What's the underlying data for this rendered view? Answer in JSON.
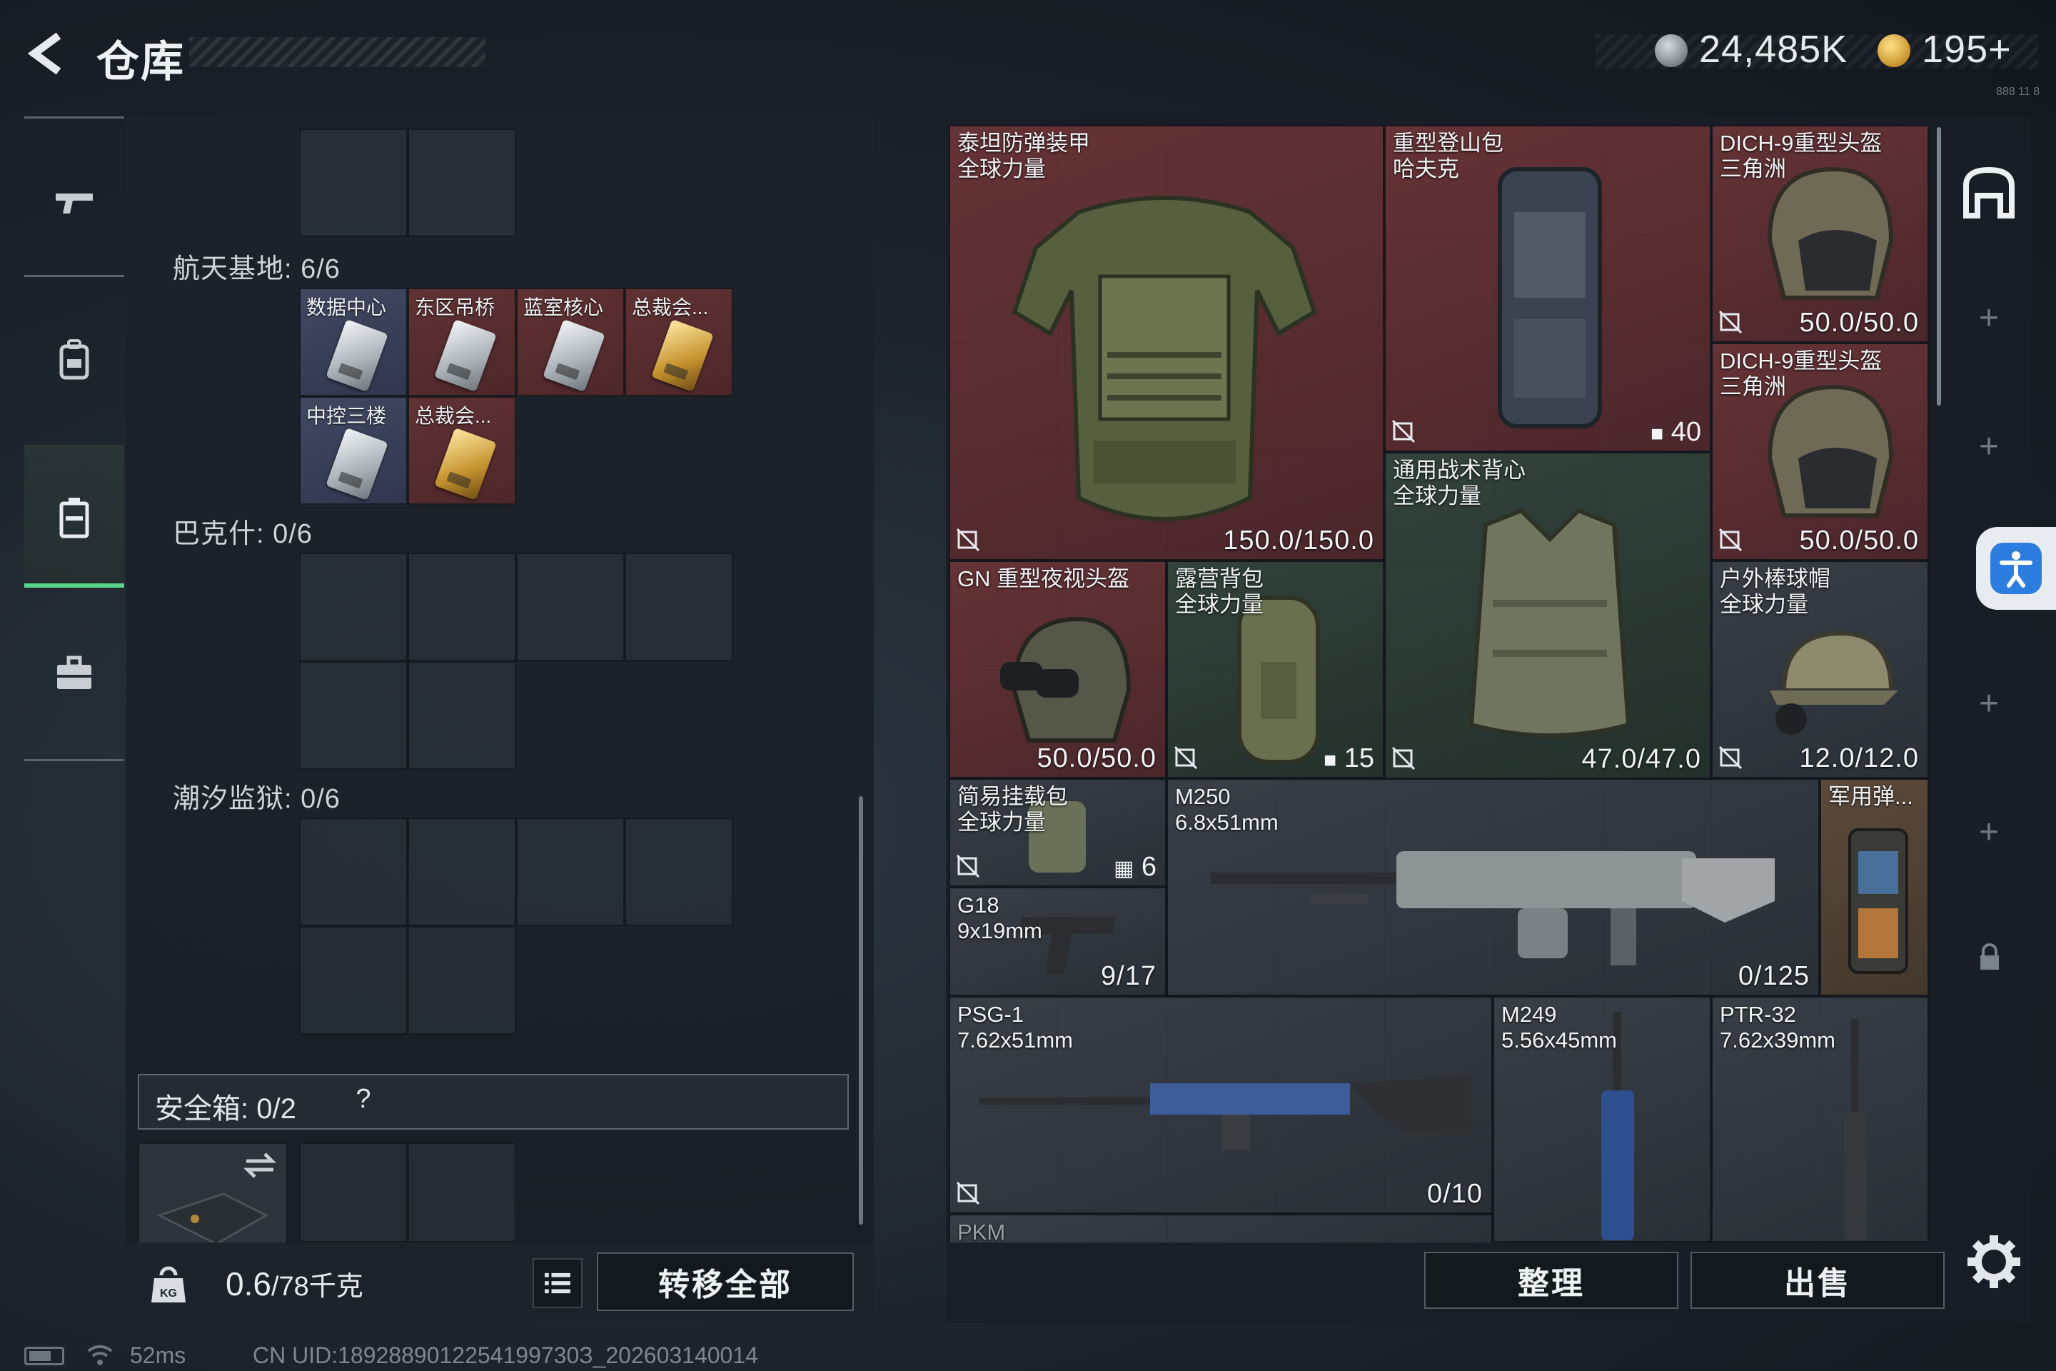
{
  "header": {
    "title": "仓库",
    "silver_amount": "24,485K",
    "gold_amount": "195+",
    "version_mark": "888 11 8"
  },
  "nav": {
    "items": [
      {
        "name": "weapons",
        "icon": "pistol-icon"
      },
      {
        "name": "equipment",
        "icon": "backpack-icon"
      },
      {
        "name": "warehouse",
        "icon": "locker-icon",
        "active": true
      },
      {
        "name": "briefcase",
        "icon": "briefcase-icon"
      }
    ]
  },
  "left_panel": {
    "sections": [
      {
        "label": "航天基地: 6/6"
      },
      {
        "label": "巴克什: 0/6"
      },
      {
        "label": "潮汐监狱: 0/6"
      }
    ],
    "cards": [
      {
        "name": "数据中心",
        "tier": "blue"
      },
      {
        "name": "东区吊桥",
        "tier": "red"
      },
      {
        "name": "蓝室核心",
        "tier": "red"
      },
      {
        "name": "总裁会...",
        "tier": "red"
      },
      {
        "name": "中控三楼",
        "tier": "blue"
      },
      {
        "name": "总裁会...",
        "tier": "red"
      }
    ],
    "safebox": {
      "label": "安全箱: 0/2",
      "help": "?"
    },
    "weight": {
      "current": "0.6",
      "max": "/78千克"
    },
    "transfer_all": "转移全部"
  },
  "container": {
    "items": [
      {
        "name": "泰坦防弹装甲\n全球力量",
        "value": "150.0/150.0"
      },
      {
        "name": "重型登山包\n哈夫克",
        "value": "40"
      },
      {
        "name": "DICH-9重型头盔\n三角洲",
        "value": "50.0/50.0"
      },
      {
        "name": "DICH-9重型头盔\n三角洲",
        "value": "50.0/50.0"
      },
      {
        "name": "通用战术背心\n全球力量",
        "value": "47.0/47.0"
      },
      {
        "name": "GN 重型夜视头盔",
        "value": "50.0/50.0"
      },
      {
        "name": "露营背包\n全球力量",
        "value": "15"
      },
      {
        "name": "户外棒球帽\n全球力量",
        "value": "12.0/12.0"
      },
      {
        "name": "简易挂载包\n全球力量",
        "value": "6"
      },
      {
        "name": "M250\n6.8x51mm",
        "value": "0/125"
      },
      {
        "name": "军用弹...",
        "value": ""
      },
      {
        "name": "G18\n9x19mm",
        "value": "9/17"
      },
      {
        "name": "PSG-1\n7.62x51mm",
        "value": "0/10"
      },
      {
        "name": "M249\n5.56x45mm",
        "value": ""
      },
      {
        "name": "PTR-32\n7.62x39mm",
        "value": ""
      },
      {
        "name": "PKM",
        "value": ""
      }
    ],
    "tidy_label": "整理",
    "sell_label": "出售"
  },
  "status": {
    "ping": "52ms",
    "uid": "CN UID:1892889012254199730З_202603140014"
  },
  "colors": {
    "accent_green": "#59d68a",
    "rarity_red": "#6e3436",
    "rarity_green": "#34463c",
    "rarity_gold": "#c8932b",
    "a11y_blue": "#2d7de0"
  }
}
